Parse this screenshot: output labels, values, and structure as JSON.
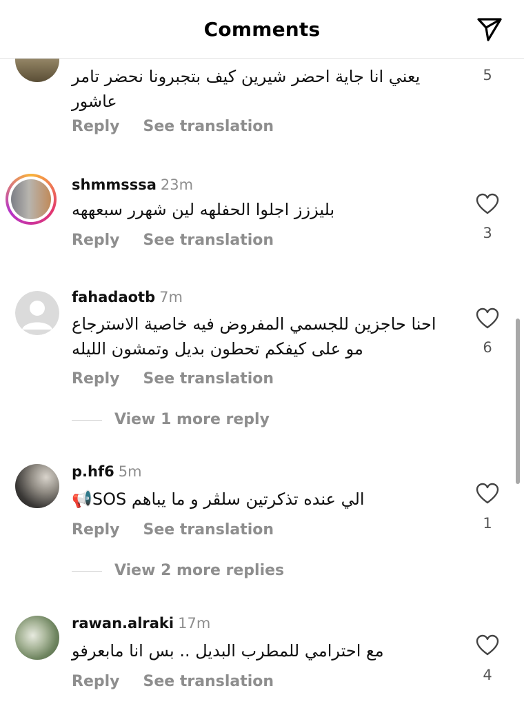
{
  "header": {
    "title": "Comments"
  },
  "comments": [
    {
      "username": "",
      "time": "",
      "text": "يعني انا جاية احضر شيرين كيف بتجبرونا نحضر تامر عاشور",
      "likes": "5",
      "reply_label": "Reply",
      "translate_label": "See translation"
    },
    {
      "username": "shmmsssa",
      "time": "23m",
      "text": "بليززز اجلوا الحفلهه لين شهرر سبعههه",
      "likes": "3",
      "reply_label": "Reply",
      "translate_label": "See translation"
    },
    {
      "username": "fahadaotb",
      "time": "7m",
      "text": "احنا حاجزين للجسمي المفروض فيه خاصية الاسترجاع مو على كيفكم تحطون بديل وتمشون الليله",
      "likes": "6",
      "reply_label": "Reply",
      "translate_label": "See translation",
      "more_replies": "View 1 more reply"
    },
    {
      "username": "p.hf6",
      "time": "5m",
      "text": "الي عنده تذكرتين سلڤر و ما يباهم SOS📢",
      "likes": "1",
      "reply_label": "Reply",
      "translate_label": "See translation",
      "more_replies": "View 2 more replies"
    },
    {
      "username": "rawan.alraki",
      "time": "17m",
      "text": "مع احترامي للمطرب البديل .. بس انا مابعرفو",
      "likes": "4",
      "reply_label": "Reply",
      "translate_label": "See translation"
    }
  ]
}
